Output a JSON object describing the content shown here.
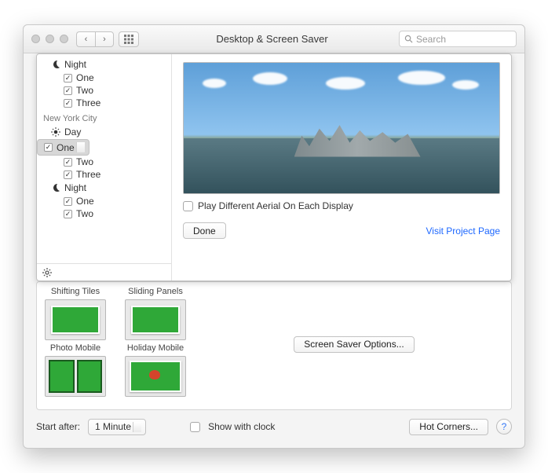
{
  "window": {
    "title": "Desktop & Screen Saver"
  },
  "search": {
    "placeholder": "Search"
  },
  "tree": {
    "group1": {
      "night_label": "Night",
      "items": [
        "One",
        "Two",
        "Three"
      ]
    },
    "group2": {
      "header": "New York City",
      "day_label": "Day",
      "day_items": [
        "One",
        "Two",
        "Three"
      ],
      "night_label": "Night",
      "night_items": [
        "One",
        "Two"
      ]
    },
    "selected": "One"
  },
  "panel": {
    "play_different_label": "Play Different Aerial On Each Display",
    "done_label": "Done",
    "visit_link": "Visit Project Page"
  },
  "savers": {
    "col1": {
      "top": "Shifting Tiles",
      "bottom": "Photo Mobile"
    },
    "col2": {
      "top": "Sliding Panels",
      "bottom": "Holiday Mobile"
    },
    "options_label": "Screen Saver Options..."
  },
  "bottom": {
    "start_after_label": "Start after:",
    "start_after_value": "1 Minute",
    "show_clock_label": "Show with clock",
    "hot_corners_label": "Hot Corners..."
  }
}
